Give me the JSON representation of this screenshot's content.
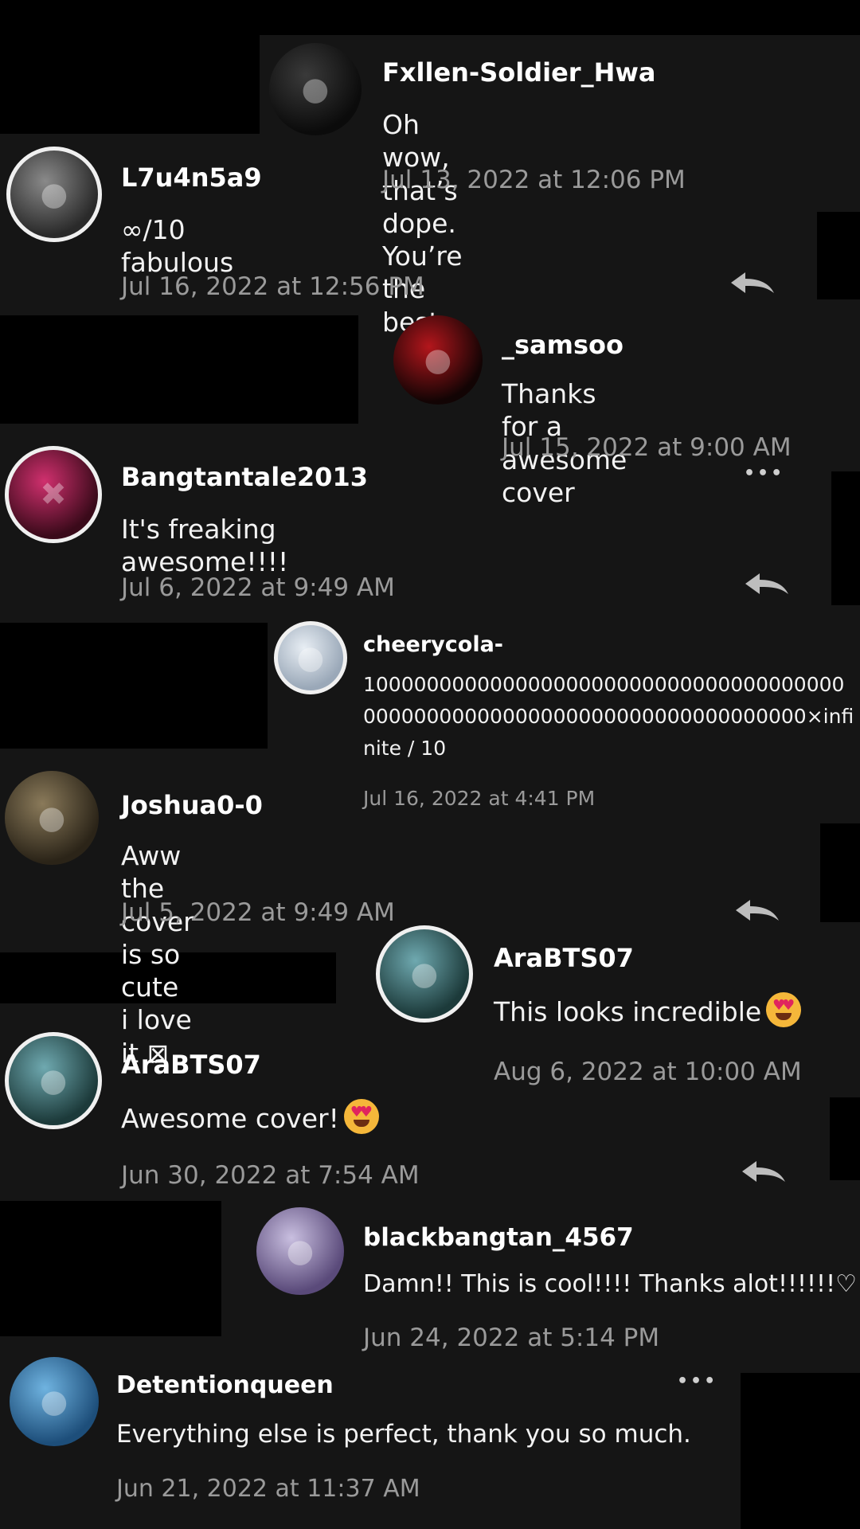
{
  "comments": [
    {
      "user": "Fxllen-Soldier_Hwa",
      "text": "Oh wow, that’s dope. You’re the best.",
      "time": "Jul 13, 2022 at 12:06 PM"
    },
    {
      "user": "L7u4n5a9",
      "text": "∞/10 fabulous",
      "time": "Jul 16, 2022 at 12:56 PM"
    },
    {
      "user": "_samsoo",
      "text": "Thanks for a awesome cover",
      "time": "Jul 15, 2022 at 9:00 AM"
    },
    {
      "user": "Bangtantale2013",
      "text": "It's freaking awesome!!!!",
      "time": "Jul 6, 2022 at 9:49 AM"
    },
    {
      "user": "cheerycola-",
      "text": "1000000000000000000000000000000000000000000000000000000000000000000000000×infinite / 10",
      "time": "Jul 16, 2022 at 4:41 PM"
    },
    {
      "user": "Joshua0-0",
      "text": "Aww the cover is so cute i love it ⊠",
      "time": "Jul 5, 2022 at 9:49 AM"
    },
    {
      "user": "AraBTS07",
      "text": "This looks incredible",
      "time": "Aug 6, 2022 at 10:00 AM"
    },
    {
      "user": "AraBTS07",
      "text": "Awesome cover!",
      "time": "Jun 30, 2022 at 7:54 AM"
    },
    {
      "user": "blackbangtan_4567",
      "text": "Damn!! This is cool!!!! Thanks alot!!!!!!♡",
      "time": "Jun 24, 2022 at 5:14 PM"
    },
    {
      "user": "Detentionqueen",
      "text": "Everything else is perfect, thank you so much.",
      "time": "Jun 21, 2022 at 11:37 AM"
    }
  ],
  "more_icon": "•••",
  "colors": {
    "background": "#151515",
    "timestamp": "#9a9a9a",
    "redaction": "#000000"
  }
}
